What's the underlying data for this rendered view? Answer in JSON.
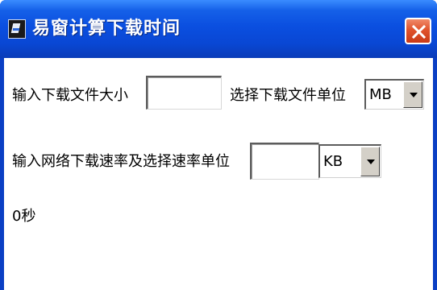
{
  "window": {
    "title": "易窗计算下载时间",
    "app_icon": "app-icon",
    "close_icon": "close-icon",
    "colors": {
      "titlebar": "#0b4fe0",
      "close_button": "#e0532c",
      "client": "#ffffff"
    }
  },
  "form": {
    "file_size_label": "输入下载文件大小",
    "file_size_value": "",
    "file_unit_label": "选择下载文件单位",
    "file_unit_selected": "MB",
    "speed_label": "输入网络下载速率及选择速率单位",
    "speed_value": "",
    "speed_unit_selected": "KB",
    "result_text": "0秒"
  }
}
